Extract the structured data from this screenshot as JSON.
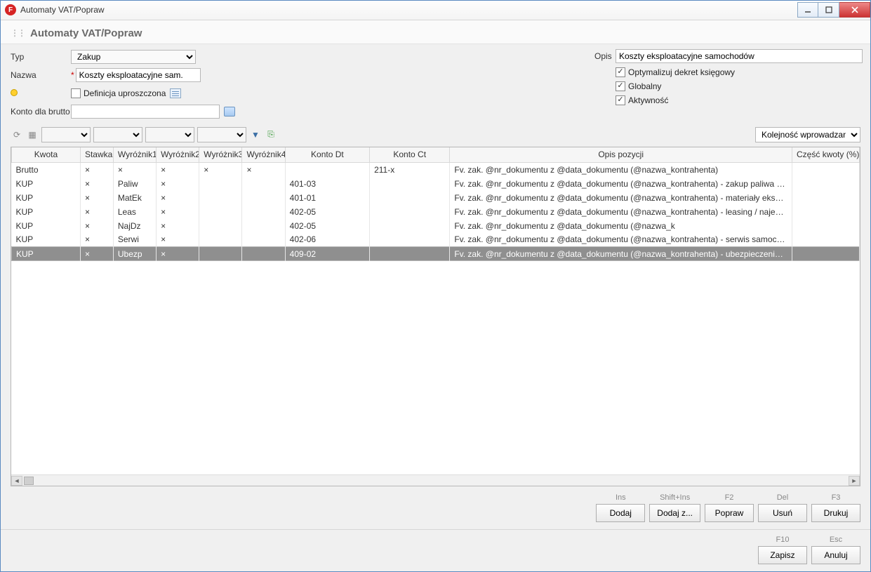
{
  "titlebar": {
    "title": "Automaty VAT/Popraw"
  },
  "subheader": {
    "title": "Automaty VAT/Popraw"
  },
  "form": {
    "typ_label": "Typ",
    "typ_value": "Zakup",
    "nazwa_label": "Nazwa",
    "nazwa_value": "Koszty eksploatacyjne sam.",
    "def_uproszczona_label": "Definicja uproszczona",
    "konto_brutto_label": "Konto dla brutto",
    "konto_brutto_value": "",
    "opis_label": "Opis",
    "opis_value": "Koszty eksploatacyjne samochodów",
    "opt_dekret_label": "Optymalizuj dekret księgowy",
    "globalny_label": "Globalny",
    "aktywnosc_label": "Aktywność"
  },
  "sort": {
    "value": "Kolejność wprowadzania"
  },
  "columns": {
    "kwota": "Kwota",
    "stawka": "Stawka",
    "w1": "Wyróżnik1",
    "w2": "Wyróżnik2",
    "w3": "Wyróżnik3",
    "w4": "Wyróżnik4",
    "dt": "Konto Dt",
    "ct": "Konto Ct",
    "opis": "Opis pozycji",
    "czesc": "Część kwoty (%)"
  },
  "rows": [
    {
      "kwota": "Brutto",
      "stawka": "×",
      "w1": "×",
      "w2": "×",
      "w3": "×",
      "w4": "×",
      "dt": "",
      "ct": "211-x",
      "opis": "Fv. zak. @nr_dokumentu z @data_dokumentu (@nazwa_kontrahenta)",
      "czesc": ""
    },
    {
      "kwota": "KUP",
      "stawka": "×",
      "w1": "Paliw",
      "w2": "×",
      "w3": "",
      "w4": "",
      "dt": "401-03",
      "ct": "",
      "opis": "Fv. zak. @nr_dokumentu z @data_dokumentu (@nazwa_kontrahenta) - zakup paliwa do samochodu",
      "czesc": ""
    },
    {
      "kwota": "KUP",
      "stawka": "×",
      "w1": "MatEk",
      "w2": "×",
      "w3": "",
      "w4": "",
      "dt": "401-01",
      "ct": "",
      "opis": "Fv. zak. @nr_dokumentu z @data_dokumentu (@nazwa_kontrahenta) - materiały eksploatacyjne sa",
      "czesc": ""
    },
    {
      "kwota": "KUP",
      "stawka": "×",
      "w1": "Leas",
      "w2": "×",
      "w3": "",
      "w4": "",
      "dt": "402-05",
      "ct": "",
      "opis": "Fv. zak. @nr_dokumentu z @data_dokumentu (@nazwa_kontrahenta) - leasing / najem / dzierżawa",
      "czesc": ""
    },
    {
      "kwota": "KUP",
      "stawka": "×",
      "w1": "NajDz",
      "w2": "×",
      "w3": "",
      "w4": "",
      "dt": "402-05",
      "ct": "",
      "opis": "Fv. zak. @nr_dokumentu z @data_dokumentu (@nazwa_k",
      "czesc": ""
    },
    {
      "kwota": "KUP",
      "stawka": "×",
      "w1": "Serwi",
      "w2": "×",
      "w3": "",
      "w4": "",
      "dt": "402-06",
      "ct": "",
      "opis": "Fv. zak. @nr_dokumentu z @data_dokumentu (@nazwa_kontrahenta) - serwis samochodu",
      "czesc": ""
    },
    {
      "kwota": "KUP",
      "stawka": "×",
      "w1": "Ubezp",
      "w2": "×",
      "w3": "",
      "w4": "",
      "dt": "409-02",
      "ct": "",
      "opis": "Fv. zak. @nr_dokumentu z @data_dokumentu (@nazwa_kontrahenta) - ubezpieczenie samochodu",
      "czesc": "",
      "selected": true
    }
  ],
  "buttons": {
    "dodaj": {
      "short": "Ins",
      "label": "Dodaj"
    },
    "dodajz": {
      "short": "Shift+Ins",
      "label": "Dodaj z..."
    },
    "popraw": {
      "short": "F2",
      "label": "Popraw"
    },
    "usun": {
      "short": "Del",
      "label": "Usuń"
    },
    "drukuj": {
      "short": "F3",
      "label": "Drukuj"
    },
    "zapisz": {
      "short": "F10",
      "label": "Zapisz"
    },
    "anuluj": {
      "short": "Esc",
      "label": "Anuluj"
    }
  }
}
